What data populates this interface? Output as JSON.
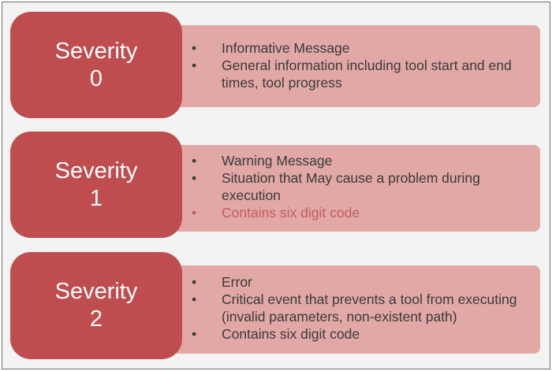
{
  "items": [
    {
      "title": "Severity",
      "level": "0",
      "bullets": [
        {
          "text": "Informative Message",
          "highlight": false
        },
        {
          "text": "General information including tool start and end times, tool progress",
          "highlight": false
        }
      ]
    },
    {
      "title": "Severity",
      "level": "1",
      "bullets": [
        {
          "text": "Warning Message",
          "highlight": false
        },
        {
          "text": "Situation that May cause a problem during execution",
          "highlight": false
        },
        {
          "text": "Contains six digit code",
          "highlight": true
        }
      ]
    },
    {
      "title": "Severity",
      "level": "2",
      "bullets": [
        {
          "text": "Error",
          "highlight": false
        },
        {
          "text": "Critical event that prevents a tool from executing (invalid parameters, non-existent path)",
          "highlight": false
        },
        {
          "text": "Contains six digit code",
          "highlight": false
        }
      ]
    }
  ],
  "bullet_glyph": "•",
  "colors": {
    "box": "#bf4c4e",
    "panel": "#e1a8a5",
    "text": "#3a3a3a",
    "highlight_text": "#c45d5f",
    "background": "#f3f3f3"
  }
}
